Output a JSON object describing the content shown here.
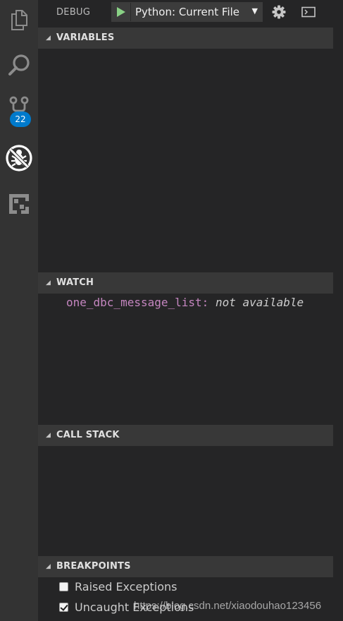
{
  "activity_bar": {
    "items": [
      {
        "name": "explorer",
        "icon": "files-icon"
      },
      {
        "name": "search",
        "icon": "search-icon"
      },
      {
        "name": "source-control",
        "icon": "source-control-icon"
      },
      {
        "name": "debug",
        "icon": "debug-icon"
      },
      {
        "name": "extensions",
        "icon": "extensions-icon"
      }
    ],
    "source_control_badge": "22"
  },
  "toolbar": {
    "title": "DEBUG",
    "config_select": {
      "selected": "Python: Current File"
    },
    "icons": [
      "start-debug-icon",
      "gear-icon",
      "terminal-icon"
    ]
  },
  "panels": {
    "variables": {
      "title": "VARIABLES"
    },
    "watch": {
      "title": "WATCH",
      "expressions": [
        {
          "name": "one_dbc_message_list:",
          "value": "not available"
        }
      ]
    },
    "call_stack": {
      "title": "CALL STACK"
    },
    "breakpoints": {
      "title": "BREAKPOINTS",
      "items": [
        {
          "label": "Raised Exceptions",
          "checked": false
        },
        {
          "label": "Uncaught Exceptions",
          "checked": true
        }
      ]
    }
  },
  "watermark": "https://blog.csdn.net/xiaodouhao123456",
  "colors": {
    "activity_bar_bg": "#333333",
    "sidebar_bg": "#252526",
    "panel_header_bg": "#383838",
    "badge": "#007acc",
    "watch_name": "#c586c0",
    "play_green": "#89d185"
  }
}
